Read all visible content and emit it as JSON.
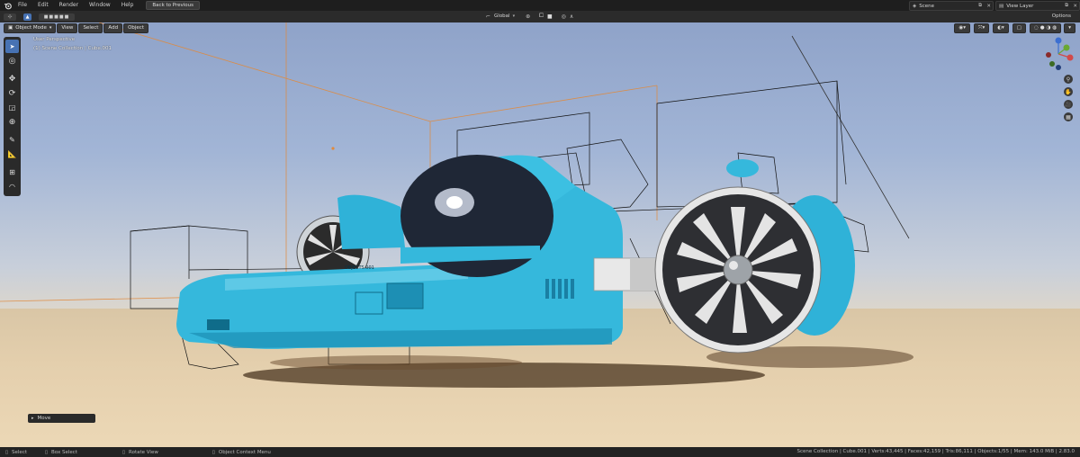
{
  "topbar": {
    "menus": [
      "File",
      "Edit",
      "Render",
      "Window",
      "Help"
    ],
    "back_button": "Back to Previous",
    "scene_name": "Scene",
    "view_layer": "View Layer"
  },
  "header": {
    "transform_orientation": "Global",
    "options_label": "Options"
  },
  "viewport": {
    "mode": "Object Mode",
    "menus": [
      "View",
      "Select",
      "Add",
      "Object"
    ],
    "perspective_label": "User Perspective",
    "collection_label": "(1) Scene Collection | Cube.001",
    "object_label": "OBJECTS.001"
  },
  "last_operator": "Move",
  "statusbar": {
    "select": "Select",
    "box_select": "Box Select",
    "rotate_view": "Rotate View",
    "context_menu": "Object Context Menu",
    "stats": "Scene Collection | Cube.001 | Verts:43,445 | Faces:42,159 | Tris:86,111 | Objects:1/55 | Mem: 143.0 MiB | 2.83.0"
  },
  "colors": {
    "accent": "#4772b3",
    "vehicle": "#35b8dc",
    "sky": "#9cb0d3",
    "ground": "#e2cdab",
    "selection": "#e08a3c"
  }
}
